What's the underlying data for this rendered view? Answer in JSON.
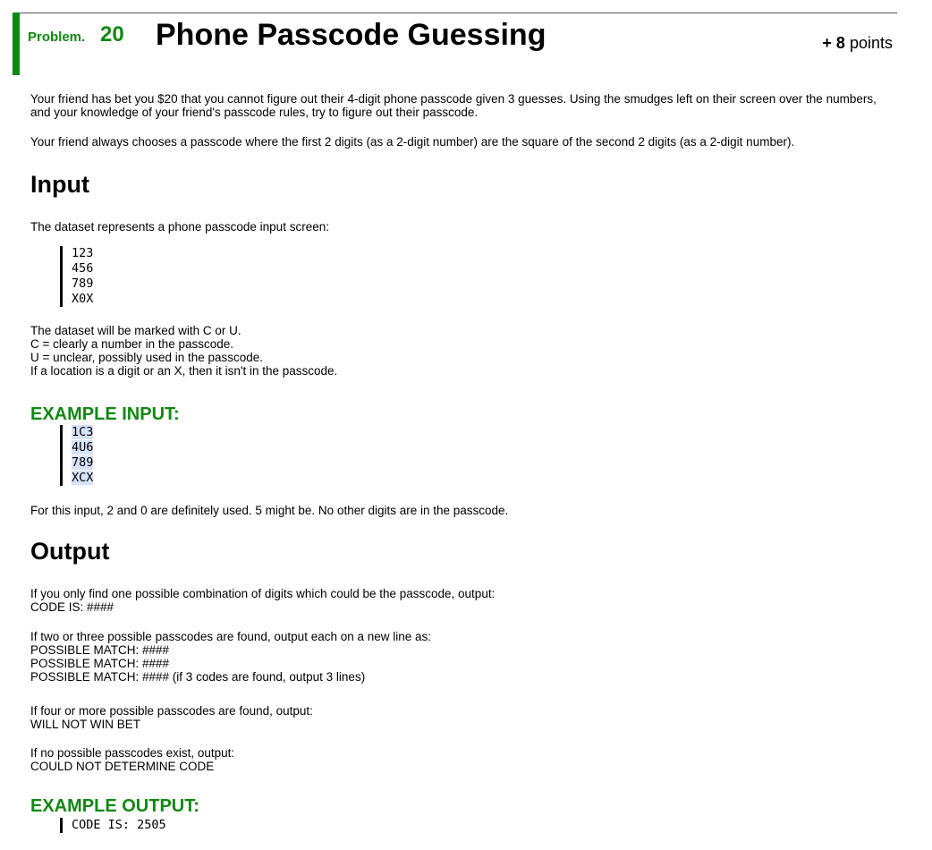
{
  "header": {
    "problem_label": "Problem.",
    "problem_number": "20",
    "title": "Phone Passcode Guessing",
    "points_prefix": "+ 8",
    "points_suffix": " points",
    "accent_color": "#118811"
  },
  "intro": {
    "p1": "Your friend has bet you $20 that you cannot figure out their 4-digit phone passcode given 3 guesses. Using the smudges left on their screen over the numbers, and your knowledge of your friend's passcode rules, try to figure out their passcode.",
    "p2": "Your friend always chooses a passcode where the first 2 digits (as a 2-digit number) are the square of the second 2 digits (as a 2-digit number)."
  },
  "input_section": {
    "heading": "Input",
    "desc": "The dataset represents a phone passcode input screen:",
    "keypad": [
      "123",
      "456",
      "789",
      "X0X"
    ],
    "rules": [
      "The dataset will be marked with C or U.",
      "C = clearly a number in the passcode.",
      "U = unclear, possibly used in the passcode.",
      "If a location is a digit or an X, then it isn't in the passcode."
    ]
  },
  "example_input": {
    "heading": "EXAMPLE INPUT:",
    "lines": [
      "1C3",
      "4U6",
      "789",
      "XCX"
    ],
    "note": "For this input, 2 and 0 are definitely used. 5 might be. No other digits are in the passcode."
  },
  "output_section": {
    "heading": "Output",
    "p1": [
      "If you only find one possible combination of digits which could be the passcode, output:",
      "CODE IS: ####"
    ],
    "p2": [
      "If two or three possible passcodes are found, output each on a new line as:",
      "POSSIBLE MATCH: ####",
      "POSSIBLE MATCH: ####",
      "POSSIBLE MATCH: #### (if 3 codes are found, output 3 lines)"
    ],
    "p3": [
      "If four or more possible passcodes are found, output:",
      "WILL NOT WIN BET"
    ],
    "p4": [
      "If no possible passcodes exist, output:",
      "COULD NOT DETERMINE CODE"
    ]
  },
  "example_output": {
    "heading": "EXAMPLE OUTPUT:",
    "lines": [
      "CODE IS: 2505"
    ]
  }
}
